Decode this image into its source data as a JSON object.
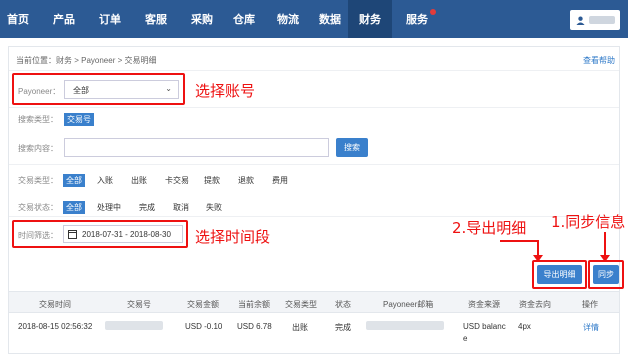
{
  "nav": {
    "items": [
      "首页",
      "产品",
      "订单",
      "客服",
      "采购",
      "仓库",
      "物流",
      "数据",
      "财务",
      "服务"
    ],
    "active": "财务"
  },
  "breadcrumb": "当前位置：财务 > Payoneer > 交易明细",
  "help_link": "查看帮助",
  "filters": {
    "payoneer_label": "Payoneer：",
    "payoneer_value": "全部",
    "search_type_label": "搜索类型：",
    "search_type_value": "交易号",
    "search_content_label": "搜索内容：",
    "search_button": "搜索",
    "txn_type_label": "交易类型：",
    "txn_types": [
      "全部",
      "入账",
      "出账",
      "卡交易",
      "提款",
      "退款",
      "费用"
    ],
    "txn_status_label": "交易状态：",
    "txn_statuses": [
      "全部",
      "处理中",
      "完成",
      "取消",
      "失败"
    ],
    "time_label": "时间筛选：",
    "date_range": "2018-07-31 - 2018-08-30"
  },
  "annotations": {
    "select_account": "选择账号",
    "select_time": "选择时间段",
    "export_step": "2.导出明细",
    "sync_step": "1.同步信息"
  },
  "actions": {
    "export": "导出明细",
    "sync": "同步"
  },
  "table": {
    "headers": [
      "交易时间",
      "交易号",
      "交易金额",
      "当前余额",
      "交易类型",
      "状态",
      "Payoneer邮箱",
      "资金来源",
      "资金去向",
      "操作"
    ],
    "row": {
      "time": "2018-08-15 02:56:32",
      "amount": "USD -0.10",
      "balance": "USD 6.78",
      "type": "出账",
      "status": "完成",
      "source_line1": "USD balanc",
      "source_line2": "e",
      "dest": "4px",
      "action": "详情"
    }
  },
  "colors": {
    "nav_bg": "#2c5a94",
    "primary": "#3a80cc",
    "annotation": "#e11111"
  }
}
